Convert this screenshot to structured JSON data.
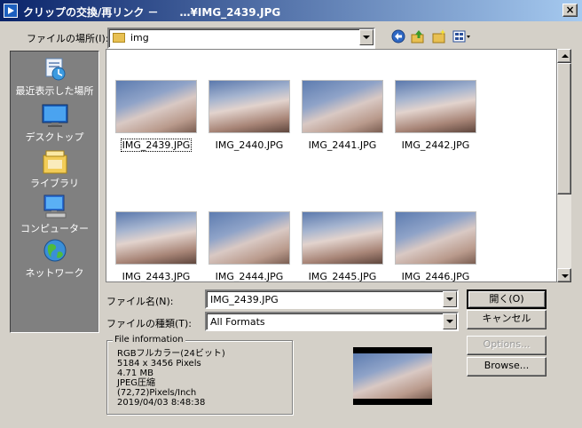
{
  "window": {
    "title": "クリップの交換/再リンク －　　…¥IMG_2439.JPG",
    "close_label": "×"
  },
  "location": {
    "label": "ファイルの場所(I):",
    "value": "img"
  },
  "places": [
    {
      "label": "最近表示した場所",
      "icon": "recent-places-icon"
    },
    {
      "label": "デスクトップ",
      "icon": "desktop-icon"
    },
    {
      "label": "ライブラリ",
      "icon": "libraries-icon"
    },
    {
      "label": "コンピューター",
      "icon": "computer-icon"
    },
    {
      "label": "ネットワーク",
      "icon": "network-icon"
    }
  ],
  "files": [
    {
      "name": "IMG_2439.JPG",
      "selected": true
    },
    {
      "name": "IMG_2440.JPG"
    },
    {
      "name": "IMG_2441.JPG"
    },
    {
      "name": "IMG_2442.JPG"
    },
    {
      "name": "IMG_2443.JPG"
    },
    {
      "name": "IMG_2444.JPG"
    },
    {
      "name": "IMG_2445.JPG"
    },
    {
      "name": "IMG_2446.JPG"
    }
  ],
  "filename": {
    "label": "ファイル名(N):",
    "value": "IMG_2439.JPG"
  },
  "filetype": {
    "label": "ファイルの種類(T):",
    "value": "All Formats"
  },
  "buttons": {
    "open": "開く(O)",
    "cancel": "キャンセル",
    "options": "Options...",
    "browse": "Browse..."
  },
  "file_info": {
    "legend": "File information",
    "lines": [
      "RGBフルカラー(24ビット)",
      "5184 x 3456 Pixels",
      "4.71 MB",
      "JPEG圧縮",
      "(72,72)Pixels/Inch",
      "2019/04/03  8:48:38"
    ]
  },
  "colors": {
    "titlebar_start": "#0a246a",
    "titlebar_end": "#a6caf0",
    "dialog_bg": "#d4d0c8",
    "places_bg": "#808080"
  }
}
